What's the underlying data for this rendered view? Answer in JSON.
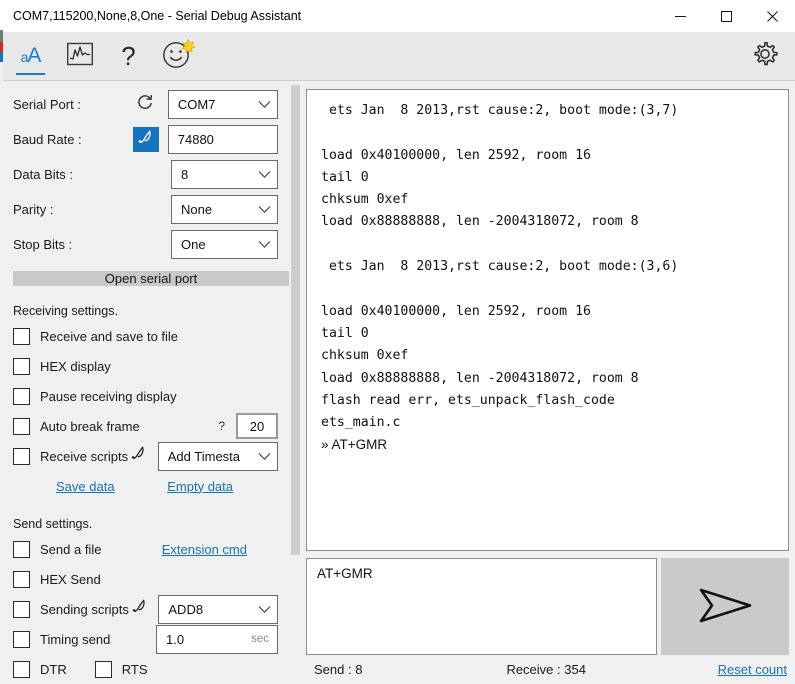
{
  "window": {
    "title": "COM7,115200,None,8,One - Serial Debug Assistant",
    "minimize_label": "minimize-icon",
    "maximize_label": "maximize-icon",
    "close_label": "close-icon"
  },
  "toolbar": {
    "items": [
      {
        "name": "text-display-tab",
        "label_small": "a",
        "label_large": "A",
        "active": true
      },
      {
        "name": "waveform-tab",
        "icon": "waveform-icon"
      },
      {
        "name": "help-tab",
        "label": "?"
      },
      {
        "name": "smiley-tab",
        "icon": "smiley-icon"
      }
    ],
    "settings_icon": "gear-icon"
  },
  "serial_settings": {
    "port": {
      "label": "Serial Port :",
      "value": "COM7",
      "refresh_icon": "refresh-icon"
    },
    "baud": {
      "label": "Baud Rate :",
      "value": "74880",
      "script_icon": "pen-script-icon"
    },
    "data_bits": {
      "label": "Data Bits :",
      "value": "8"
    },
    "parity": {
      "label": "Parity :",
      "value": "None"
    },
    "stop_bits": {
      "label": "Stop Bits :",
      "value": "One"
    },
    "open_button": "Open serial port"
  },
  "receiving": {
    "title": "Receiving settings.",
    "options": [
      {
        "label": "Receive and save to file",
        "checked": false
      },
      {
        "label": "HEX display",
        "checked": false
      },
      {
        "label": "Pause receiving display",
        "checked": false
      }
    ],
    "auto_break": {
      "label": "Auto break frame",
      "checked": false,
      "hint": "?",
      "value": "20"
    },
    "receive_scripts": {
      "label": "Receive scripts",
      "checked": false,
      "script_icon": "pen-script-icon",
      "value": "Add Timesta"
    },
    "save_data_link": "Save data",
    "empty_data_link": "Empty data"
  },
  "sending": {
    "title": "Send settings.",
    "send_file": {
      "label": "Send a file",
      "checked": false
    },
    "extension_cmd_link": "Extension cmd",
    "hex_send": {
      "label": "HEX Send",
      "checked": false
    },
    "sending_scripts": {
      "label": "Sending scripts",
      "checked": false,
      "script_icon": "pen-script-icon",
      "value": "ADD8"
    },
    "timing_send": {
      "label": "Timing send",
      "checked": false,
      "value": "1.0",
      "unit": "sec"
    },
    "dtr": {
      "label": "DTR",
      "checked": false
    },
    "rts": {
      "label": "RTS",
      "checked": false
    }
  },
  "terminal": {
    "lines": [
      {
        "text": " ets Jan  8 2013,rst cause:2, boot mode:(3,7)",
        "mono": true
      },
      {
        "text": "",
        "mono": true
      },
      {
        "text": "load 0x40100000, len 2592, room 16",
        "mono": true
      },
      {
        "text": "tail 0",
        "mono": true
      },
      {
        "text": "chksum 0xef",
        "mono": true
      },
      {
        "text": "load 0x88888888, len -2004318072, room 8",
        "mono": true
      },
      {
        "text": "",
        "mono": true
      },
      {
        "text": " ets Jan  8 2013,rst cause:2, boot mode:(3,6)",
        "mono": true
      },
      {
        "text": "",
        "mono": true
      },
      {
        "text": "load 0x40100000, len 2592, room 16",
        "mono": true
      },
      {
        "text": "tail 0",
        "mono": true
      },
      {
        "text": "chksum 0xef",
        "mono": true
      },
      {
        "text": "load 0x88888888, len -2004318072, room 8",
        "mono": true
      },
      {
        "text": "flash read err, ets_unpack_flash_code",
        "mono": true
      },
      {
        "text": "ets_main.c",
        "mono": true
      },
      {
        "text": "» AT+GMR",
        "mono": false
      }
    ]
  },
  "send_panel": {
    "input_value": "AT+GMR",
    "send_icon": "send-arrow-icon"
  },
  "statusbar": {
    "send_count": "Send : 8",
    "receive_count": "Receive : 354",
    "reset_link": "Reset count"
  },
  "colors": {
    "accent_blue": "#1673c0",
    "link_blue": "#1673c0",
    "panel_bg": "#f0f0f0",
    "button_grey": "#c8c8c8",
    "close_hover_red": "#e81123"
  }
}
